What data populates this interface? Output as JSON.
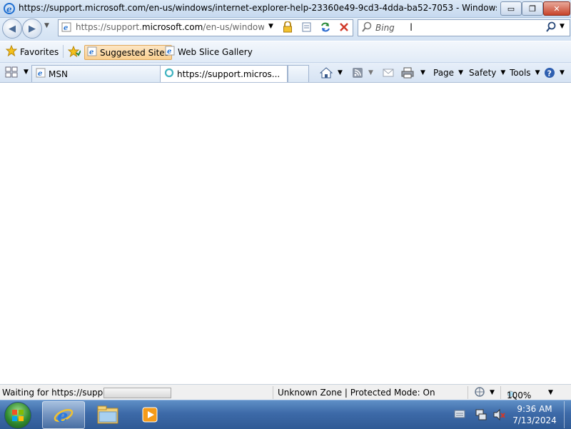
{
  "window": {
    "title": "https://support.microsoft.com/en-us/windows/internet-explorer-help-23360e49-9cd3-4dda-ba52-7053 - Windows Internet Ex...",
    "buttons": {
      "minimize": "▭",
      "restore": "❐",
      "close": "✕"
    }
  },
  "address": {
    "url_prefix": "https://support.",
    "url_domain": "microsoft.com",
    "url_rest": "/en-us/windows/in"
  },
  "search": {
    "placeholder": "Bing"
  },
  "favorites_bar": {
    "favorites_label": "Favorites",
    "items": [
      {
        "label": "Suggested Sites"
      },
      {
        "label": "Web Slice Gallery"
      }
    ]
  },
  "tabs": [
    {
      "label": "MSN",
      "active": false
    },
    {
      "label": "https://support.micros...",
      "active": true
    }
  ],
  "command_bar": {
    "page_label": "Page",
    "safety_label": "Safety",
    "tools_label": "Tools"
  },
  "status_bar": {
    "status_text": "Waiting for https://suppor",
    "progress": 0.0,
    "zone_text": "Unknown Zone | Protected Mode: On",
    "zoom": "100%"
  },
  "taskbar": {
    "time": "9:36 AM",
    "date": "7/13/2024"
  },
  "colors": {
    "taskbar": "#3d6aa8",
    "ie_blue": "#1f6fd1",
    "stop_red": "#d03a2a"
  }
}
